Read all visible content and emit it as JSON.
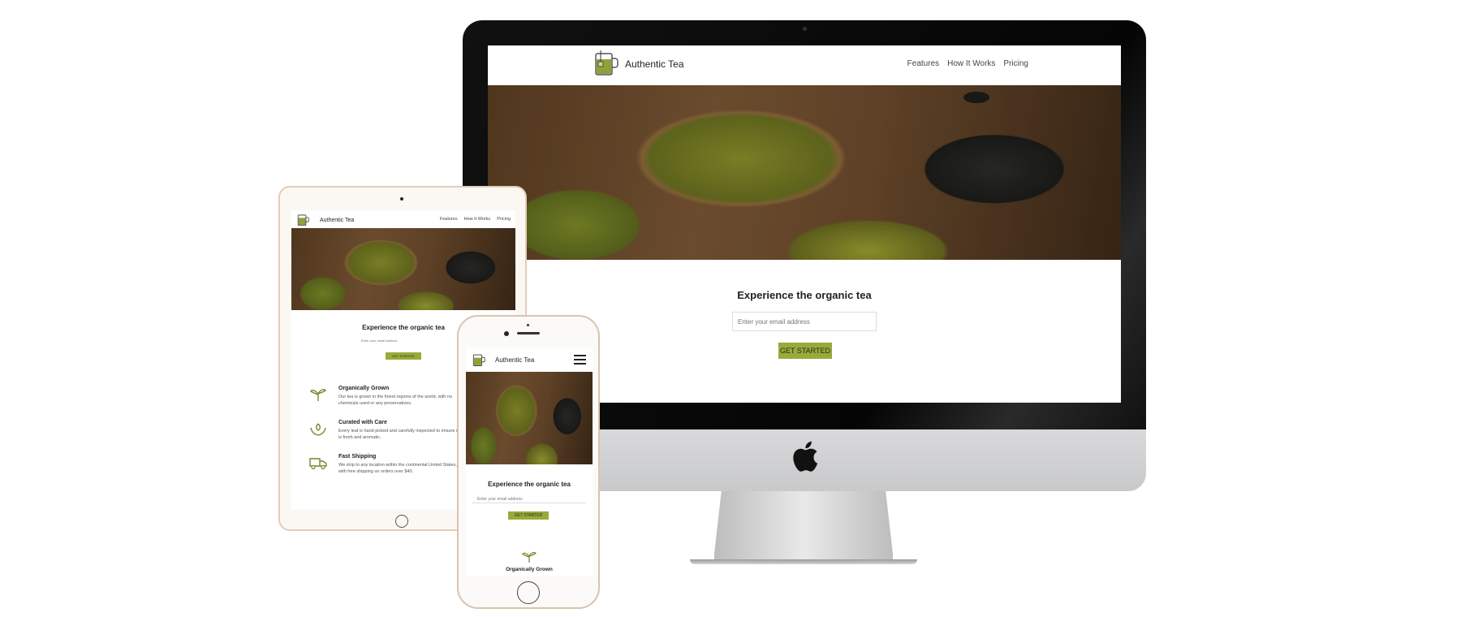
{
  "brand": "Authentic Tea",
  "nav": [
    "Features",
    "How It Works",
    "Pricing"
  ],
  "hero": {
    "headline": "Experience the organic tea",
    "email_placeholder": "Enter your email address",
    "cta_label": "GET STARTED"
  },
  "features": [
    {
      "title": "Organically Grown",
      "text": "Our tea is grown in the finest regions of the world, with no chemicals used or any preservatives.",
      "icon": "sprout-icon"
    },
    {
      "title": "Curated with Care",
      "text": "Every leaf is hand picked and carefully inspected to ensure it is fresh and aromatic.",
      "icon": "hands-leaf-icon"
    },
    {
      "title": "Fast Shipping",
      "text": "We ship to any location within the continental United States, with free shipping on orders over $40.",
      "icon": "truck-icon"
    }
  ],
  "colors": {
    "accent": "#9aaa3a",
    "accent_dark": "#6f8a2a",
    "text": "#222222"
  }
}
